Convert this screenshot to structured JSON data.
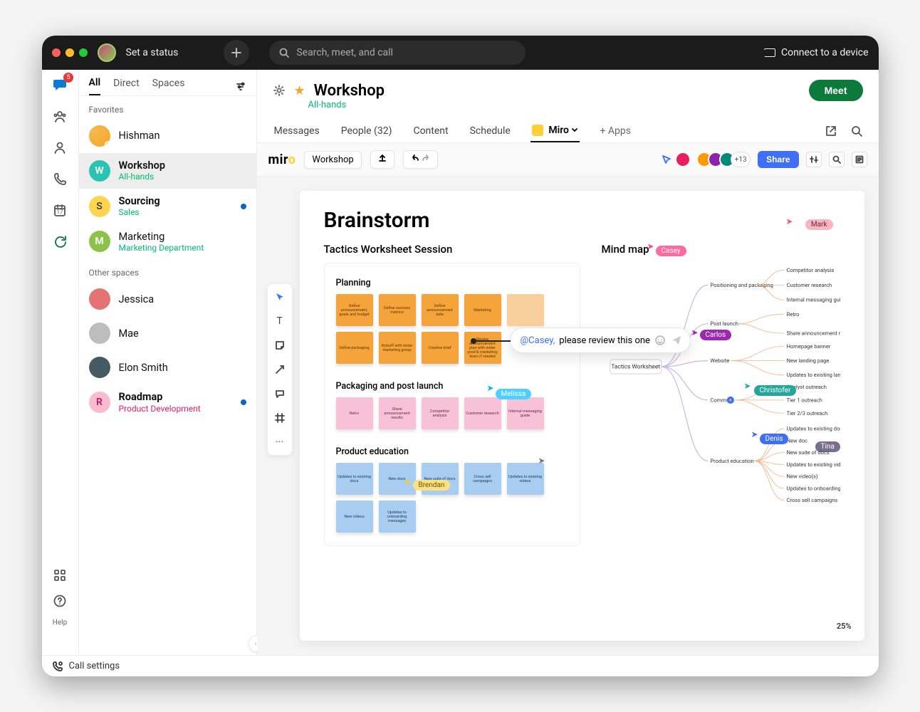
{
  "titlebar": {
    "status_prompt": "Set a status",
    "search_placeholder": "Search, meet, and call",
    "connect_label": "Connect to a device"
  },
  "rail": {
    "badge_count": "5",
    "calendar_day": "17",
    "help_label": "Help"
  },
  "sidebar": {
    "tabs": {
      "all": "All",
      "direct": "Direct",
      "spaces": "Spaces"
    },
    "favorites_label": "Favorites",
    "other_label": "Other spaces",
    "favorites": [
      {
        "name": "Hishman",
        "sub": ""
      },
      {
        "name": "Workshop",
        "sub": "All-hands"
      },
      {
        "name": "Sourcing",
        "sub": "Sales"
      },
      {
        "name": "Marketing",
        "sub": "Marketing Department"
      }
    ],
    "others": [
      {
        "name": "Jessica"
      },
      {
        "name": "Mae"
      },
      {
        "name": "Elon Smith"
      },
      {
        "name": "Roadmap",
        "sub": "Product Development"
      }
    ]
  },
  "space": {
    "title": "Workshop",
    "subtitle": "All-hands",
    "meet_label": "Meet",
    "tabs": {
      "messages": "Messages",
      "people": "People (32)",
      "content": "Content",
      "schedule": "Schedule",
      "miro": "Miro",
      "apps": "+  Apps"
    }
  },
  "miro": {
    "brand": "miro",
    "board_name": "Workshop",
    "extra_avatars": "+13",
    "share_label": "Share",
    "zoom_label": "25%"
  },
  "board": {
    "title": "Brainstorm",
    "session_heading": "Tactics Worksheet Session",
    "map_heading": "Mind map",
    "groups": {
      "planning": {
        "label": "Planning",
        "notes": [
          "Define announcement, goals and budget",
          "Define success metrics",
          "Define announcement date",
          "Marketing",
          "",
          "Define packaging",
          "Kickoff with wider marketing group",
          "Creative brief",
          "Review announcement plan with wider prod & marketing team if needed"
        ]
      },
      "packaging": {
        "label": "Packaging and post launch",
        "notes": [
          "Retro",
          "Share announcement results",
          "Competitor analysis",
          "Customer research",
          "Internal messaging guide"
        ]
      },
      "education": {
        "label": "Product education",
        "notes": [
          "Updates to existing docs",
          "New docs",
          "New suite of docs",
          "Cross sell campaigns",
          "Updates to existing videos",
          "New videos",
          "Updates to onboarding messages"
        ]
      }
    },
    "comment": {
      "mention": "@Casey,",
      "text": " please review this one"
    },
    "cursors": {
      "mark": "Mark",
      "casey": "Casey",
      "melissa": "Melissa",
      "brendan": "Brendan",
      "tina": "Tina",
      "carlos": "Carlos",
      "christofer": "Christofer",
      "denis": "Denis"
    },
    "mindmap": {
      "root": "Tactics Worksheet",
      "branches": [
        {
          "name": "Positioning and packaging",
          "children": [
            "Competitor analysis",
            "Customer research",
            "Internal messaging guide"
          ]
        },
        {
          "name": "Post launch",
          "children": [
            "Retro",
            "Share announcement results"
          ]
        },
        {
          "name": "Website",
          "children": [
            "Homepage banner",
            "New landing page",
            "Updates to existing landing"
          ]
        },
        {
          "name": "Comms",
          "children": [
            "Analyst outreach",
            "Tier 1 outreach",
            "Tier 2/3 outreach"
          ]
        },
        {
          "name": "Product education",
          "children": [
            "Updates to existing docs",
            "New doc",
            "New suite of docs",
            "Updates to existing videos",
            "New video(s)",
            "Updates to onboarding messag",
            "Cross sell campaigns"
          ]
        }
      ]
    }
  },
  "footer": {
    "call_settings": "Call settings"
  }
}
